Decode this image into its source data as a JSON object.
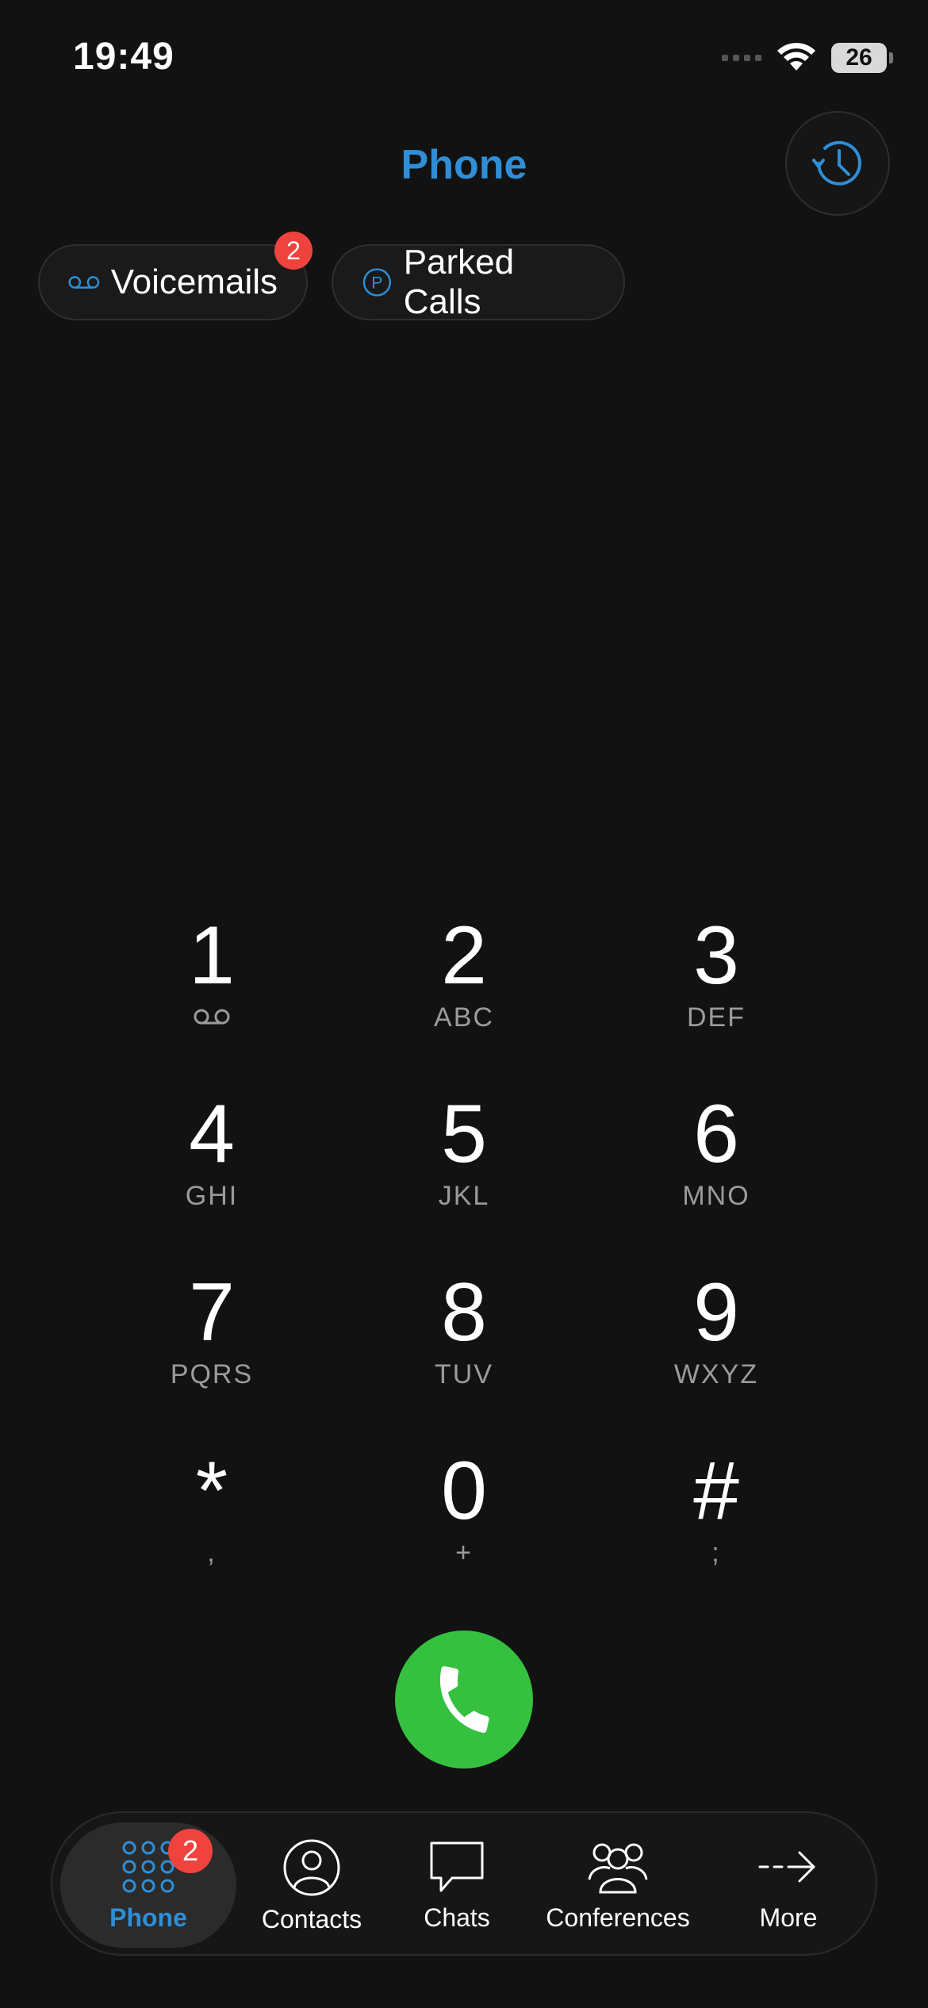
{
  "status_bar": {
    "time": "19:49",
    "battery": "26"
  },
  "header": {
    "title": "Phone"
  },
  "chips": {
    "voicemails": {
      "label": "Voicemails",
      "badge": "2"
    },
    "parked": {
      "label": "Parked Calls"
    }
  },
  "keypad": {
    "keys": [
      {
        "digit": "1",
        "letters": ""
      },
      {
        "digit": "2",
        "letters": "ABC"
      },
      {
        "digit": "3",
        "letters": "DEF"
      },
      {
        "digit": "4",
        "letters": "GHI"
      },
      {
        "digit": "5",
        "letters": "JKL"
      },
      {
        "digit": "6",
        "letters": "MNO"
      },
      {
        "digit": "7",
        "letters": "PQRS"
      },
      {
        "digit": "8",
        "letters": "TUV"
      },
      {
        "digit": "9",
        "letters": "WXYZ"
      },
      {
        "digit": "*",
        "letters": ","
      },
      {
        "digit": "0",
        "letters": "+"
      },
      {
        "digit": "#",
        "letters": ";"
      }
    ]
  },
  "tabs": [
    {
      "label": "Phone",
      "badge": "2",
      "icon": "keypad-icon"
    },
    {
      "label": "Contacts",
      "icon": "contact-icon"
    },
    {
      "label": "Chats",
      "icon": "chat-bubble-icon"
    },
    {
      "label": "Conferences",
      "icon": "group-icon"
    },
    {
      "label": "More",
      "icon": "arrow-right-icon"
    }
  ],
  "colors": {
    "accent": "#2f8ed6",
    "call": "#35c13f",
    "badge": "#f0433e",
    "background": "#121212"
  }
}
